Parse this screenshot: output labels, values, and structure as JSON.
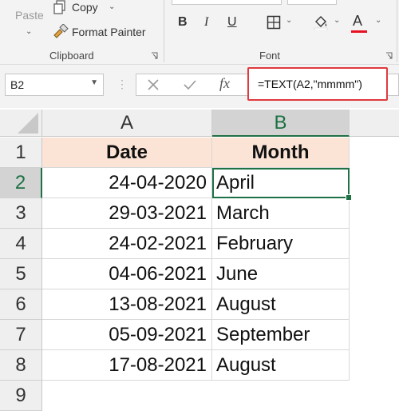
{
  "ribbon": {
    "clipboard": {
      "paste_label": "Paste",
      "copy_label": "Copy",
      "format_painter_label": "Format Painter",
      "group_label": "Clipboard"
    },
    "font": {
      "bold_label": "B",
      "italic_label": "I",
      "underline_label": "U",
      "font_color_label": "A",
      "group_label": "Font",
      "font_color_swatch": "#e81123"
    }
  },
  "formula_bar": {
    "name_box": "B2",
    "fx_label": "fx",
    "formula": "=TEXT(A2,\"mmmm\")",
    "highlight_color": "#e0393e"
  },
  "grid": {
    "columns": [
      "A",
      "B"
    ],
    "rows": [
      "1",
      "2",
      "3",
      "4",
      "5",
      "6",
      "7",
      "8",
      "9"
    ],
    "header": {
      "date": "Date",
      "month": "Month",
      "fill": "#fbe4d5"
    },
    "data": [
      {
        "date": "24-04-2020",
        "month": "April"
      },
      {
        "date": "29-03-2021",
        "month": "March"
      },
      {
        "date": "24-02-2021",
        "month": "February"
      },
      {
        "date": "04-06-2021",
        "month": "June"
      },
      {
        "date": "13-08-2021",
        "month": "August"
      },
      {
        "date": "05-09-2021",
        "month": "September"
      },
      {
        "date": "17-08-2021",
        "month": "August"
      }
    ],
    "selected_cell": "B2",
    "selection_color": "#1e7145"
  }
}
